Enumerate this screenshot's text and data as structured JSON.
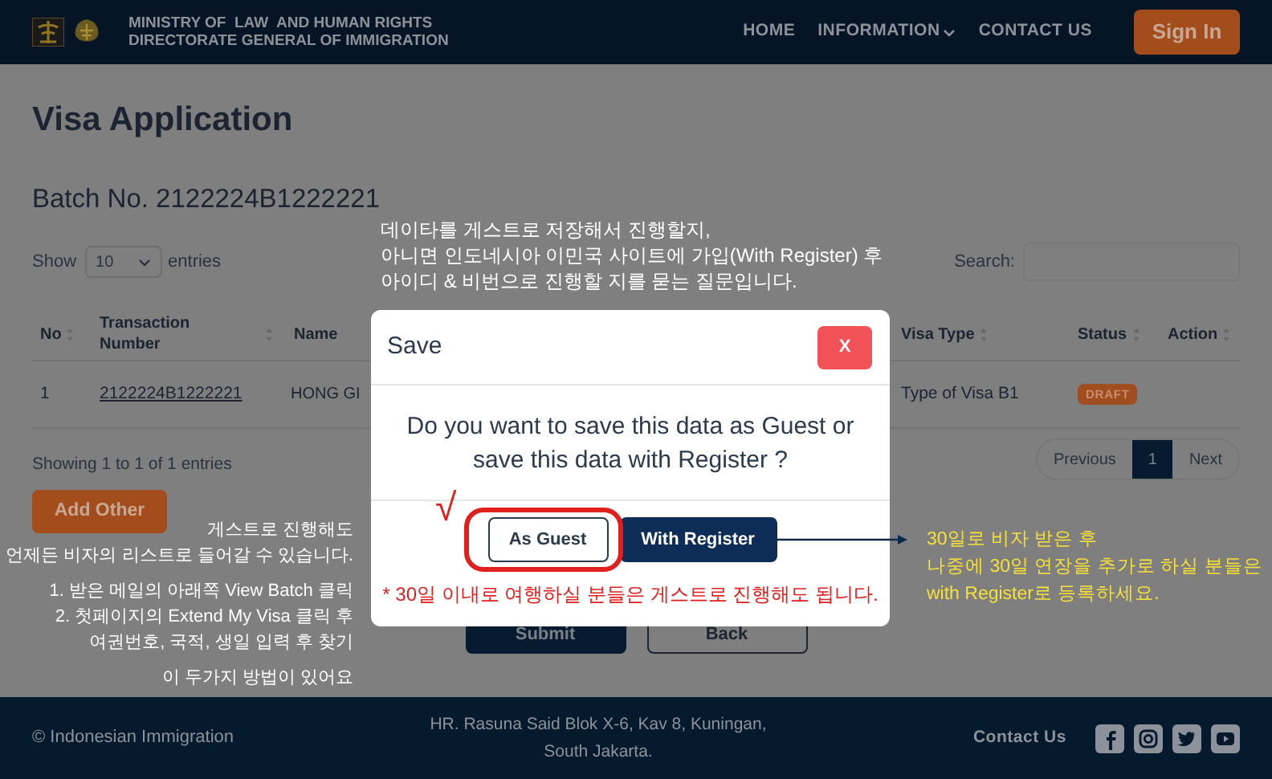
{
  "header": {
    "org_line1": "MINISTRY OF  LAW  AND HUMAN RIGHTS",
    "org_line2": "DIRECTORATE GENERAL OF IMMIGRATION",
    "nav": [
      {
        "label": "HOME",
        "dropdown": false
      },
      {
        "label": "INFORMATION",
        "dropdown": true
      },
      {
        "label": "CONTACT US",
        "dropdown": false
      }
    ],
    "sign_in": "Sign In"
  },
  "page": {
    "title": "Visa Application",
    "batch": "Batch No. 2122224B1222221",
    "show_label": "Show",
    "entries_value": "10",
    "entries_label": "entries",
    "search_label": "Search:"
  },
  "table": {
    "columns": [
      {
        "label": "No",
        "sortable": true
      },
      {
        "label": "Transaction Number",
        "sortable": true
      },
      {
        "label": "Name",
        "sortable": false
      },
      {
        "label": "Visa Type",
        "sortable": true
      },
      {
        "label": "Status",
        "sortable": true
      },
      {
        "label": "Action",
        "sortable": true
      }
    ],
    "rows": [
      {
        "no": "1",
        "transaction": "2122224B1222221",
        "name": "HONG GI",
        "visa_type": "Type of Visa B1",
        "status": "DRAFT"
      }
    ]
  },
  "info": "Showing 1 to 1 of 1 entries",
  "pagination": [
    {
      "label": "Previous",
      "selected": false
    },
    {
      "label": "1",
      "selected": true
    },
    {
      "label": "Next",
      "selected": false
    }
  ],
  "add_other": "Add Other",
  "submit": "Submit",
  "back": "Back",
  "modal": {
    "title": "Save",
    "close": "X",
    "message": "Do you want to save this data as Guest or save this data with Register ?",
    "buttons": [
      {
        "label": "As Guest",
        "kind": "outline"
      },
      {
        "label": "With Register",
        "kind": "primary"
      }
    ],
    "note": "* 30일 이내로 여행하실 분들은 게스트로 진행해도 됩니다."
  },
  "annotations": {
    "top": [
      "데이타를 게스트로 저장해서 진행할지,",
      "아니면 인도네시아 이민국 사이트에 가입(With Register) 후",
      "아이디 & 비번으로 진행할 지를 묻는 질문입니다."
    ],
    "check": "√",
    "left": [
      "게스트로 진행해도",
      "언제든 비자의 리스트로 들어갈 수 있습니다.",
      "1. 받은 메일의 아래쪽 View Batch 클릭",
      "2. 첫페이지의 Extend My Visa 클릭 후",
      "여권번호, 국적, 생일 입력 후 찾기",
      "이 두가지 방법이 있어요"
    ],
    "right": [
      "30일로 비자 받은 후",
      "나중에 30일 연장을 추가로 하실 분들은",
      "with Register로 등록하세요."
    ]
  },
  "footer": {
    "copyright": "© Indonesian Immigration",
    "address": "HR. Rasuna Said Blok X-6, Kav 8, Kuningan, South Jakarta.",
    "contact": "Contact Us"
  }
}
